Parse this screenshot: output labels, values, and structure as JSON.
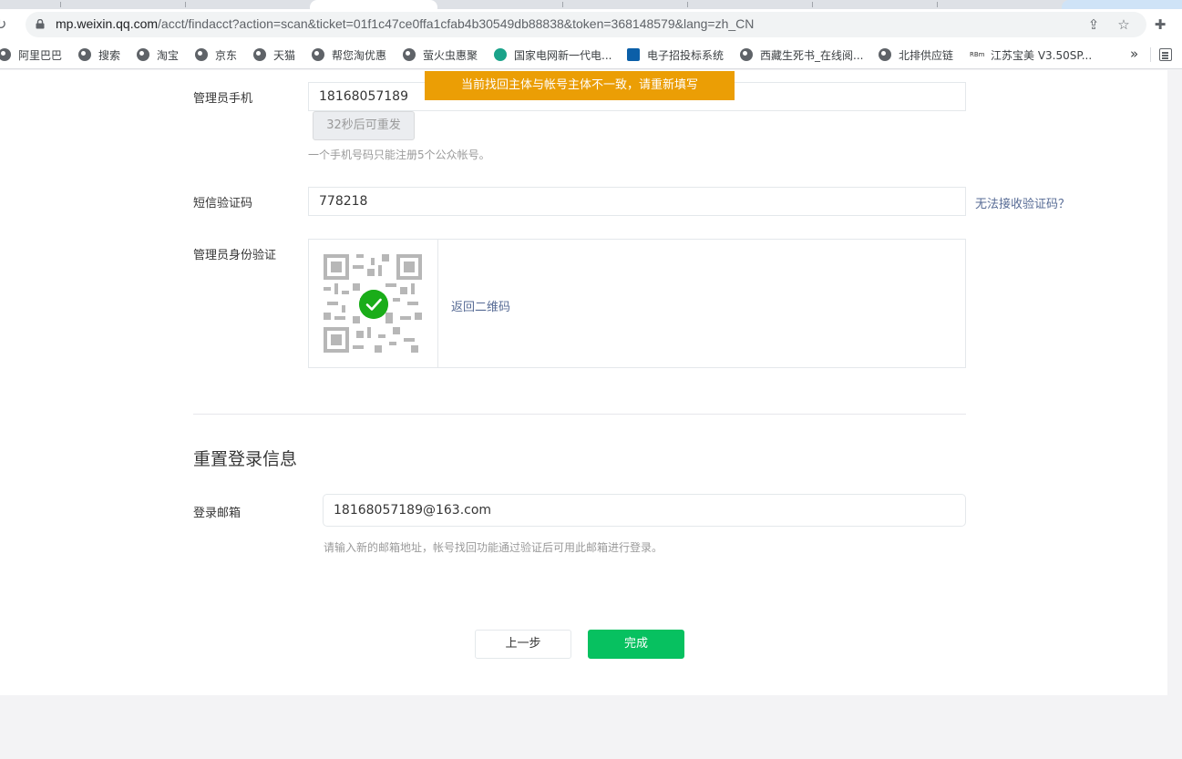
{
  "browser": {
    "url_host": "mp.weixin.qq.com",
    "url_path": "/acct/findacct?action=scan&ticket=01f1c47ce0ffa1cfab4b30549db88838&token=368148579&lang=zh_CN",
    "bookmarks": [
      {
        "label": "阿里巴巴"
      },
      {
        "label": "搜索"
      },
      {
        "label": "淘宝"
      },
      {
        "label": "京东"
      },
      {
        "label": "天猫"
      },
      {
        "label": "帮您淘优惠"
      },
      {
        "label": "萤火虫惠聚"
      },
      {
        "label": "国家电网新一代电..."
      },
      {
        "label": "电子招投标系统"
      },
      {
        "label": "西藏生死书_在线阅..."
      },
      {
        "label": "北排供应链"
      },
      {
        "label": "江苏宝美 V3.50SP...",
        "badge": "RBm"
      }
    ],
    "more_label": "»"
  },
  "toast": "当前找回主体与帐号主体不一致，请重新填写",
  "form": {
    "phone_label": "管理员手机",
    "phone_value": "18168057189",
    "resend_label": "32秒后可重发",
    "phone_tip": "一个手机号码只能注册5个公众帐号。",
    "sms_label": "短信验证码",
    "sms_value": "778218",
    "sms_help_link": "无法接收验证码？",
    "identity_label": "管理员身份验证",
    "back_to_qr": "返回二维码"
  },
  "reset_section": {
    "title": "重置登录信息",
    "email_label": "登录邮箱",
    "email_value": "18168057189@163.com",
    "email_tip": "请输入新的邮箱地址，帐号找回功能通过验证后可用此邮箱进行登录。"
  },
  "buttons": {
    "prev": "上一步",
    "done": "完成"
  },
  "colors": {
    "toast_bg": "#eb9e05",
    "primary_green": "#07c160",
    "check_green": "#1aad19",
    "link_blue": "#576b95"
  }
}
